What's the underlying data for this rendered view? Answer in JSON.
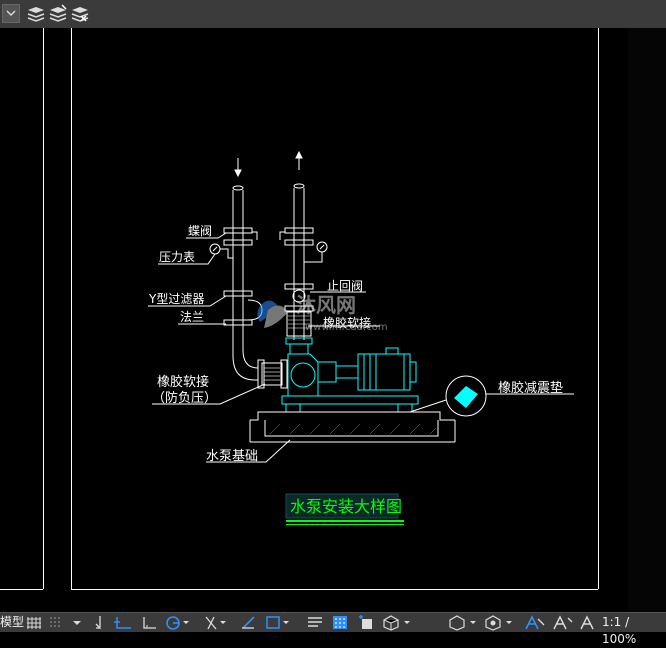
{
  "statusbar": {
    "model_tab": "模型",
    "scale": "1:1 / 100%"
  },
  "drawing": {
    "labels": {
      "butterfly_valve": "蝶阀",
      "pressure_gauge": "压力表",
      "y_strainer": "Y型过滤器",
      "flange": "法兰",
      "check_valve": "止回阀",
      "rubber_joint_top": "橡胶软接",
      "rubber_joint_left_1": "橡胶软接",
      "rubber_joint_left_2": "（防负压）",
      "damper_pad": "橡胶减震垫",
      "pump_foundation": "水泵基础",
      "title": "水泵安装大样图"
    },
    "watermark": "沐风网",
    "watermark_url": "www.mfcad.com"
  },
  "colors": {
    "toolbar_bg": "#3b3b3b",
    "canvas_bg": "#000000",
    "line_white": "#ffffff",
    "line_cyan": "#00ffff",
    "title_green": "#00ff00",
    "accent_blue": "#2f8fff"
  },
  "icons": [
    "layer-dropdown-icon",
    "layer-state-icon",
    "layer-match-icon",
    "layer-previous-icon",
    "grid-icon",
    "snap-icon",
    "ortho-icon",
    "polar-icon",
    "osnap-icon",
    "otrack-icon",
    "lineweight-icon",
    "transparency-icon",
    "selection-cycle-icon",
    "annotation-icon",
    "workspace-icon",
    "isolate-icon",
    "hardware-accel-icon",
    "clean-screen-icon"
  ]
}
